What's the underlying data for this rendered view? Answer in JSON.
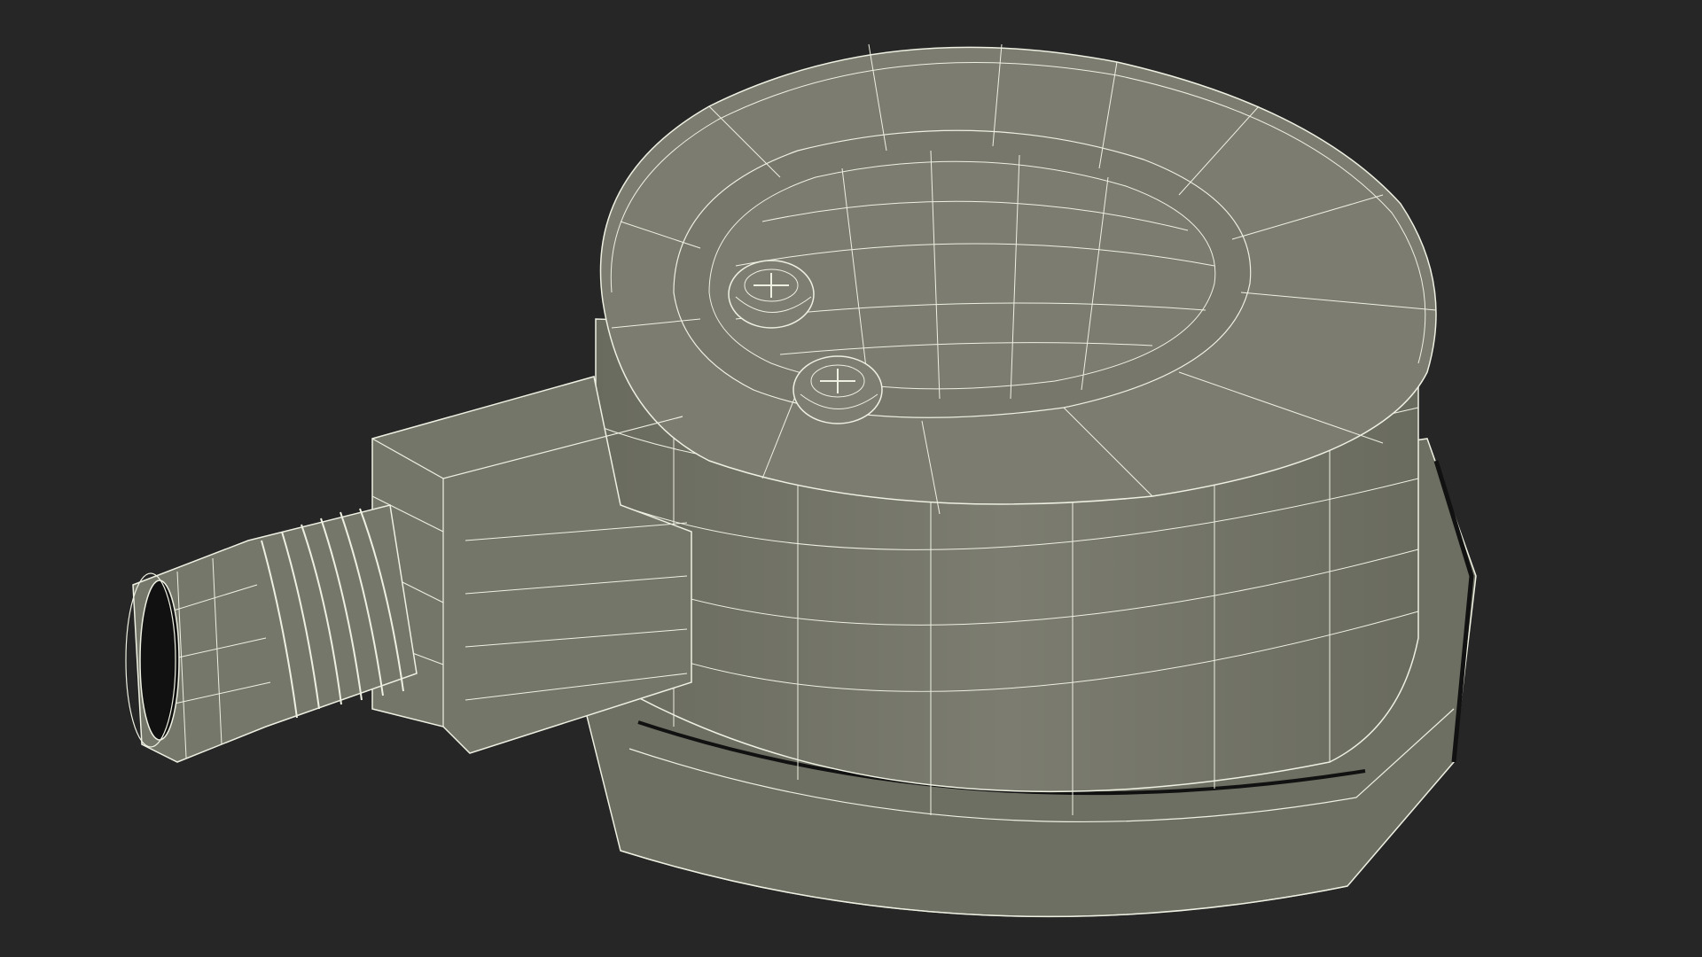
{
  "viewport": {
    "background": "#262626"
  },
  "model": {
    "subject": "pressure-gauge-wireframe",
    "colors": {
      "body": "#7c7d70",
      "body_dark": "#6a6b5f",
      "body_shadow": "#5d5e53",
      "wire": "#eef0e2",
      "hole": "#111111"
    }
  }
}
